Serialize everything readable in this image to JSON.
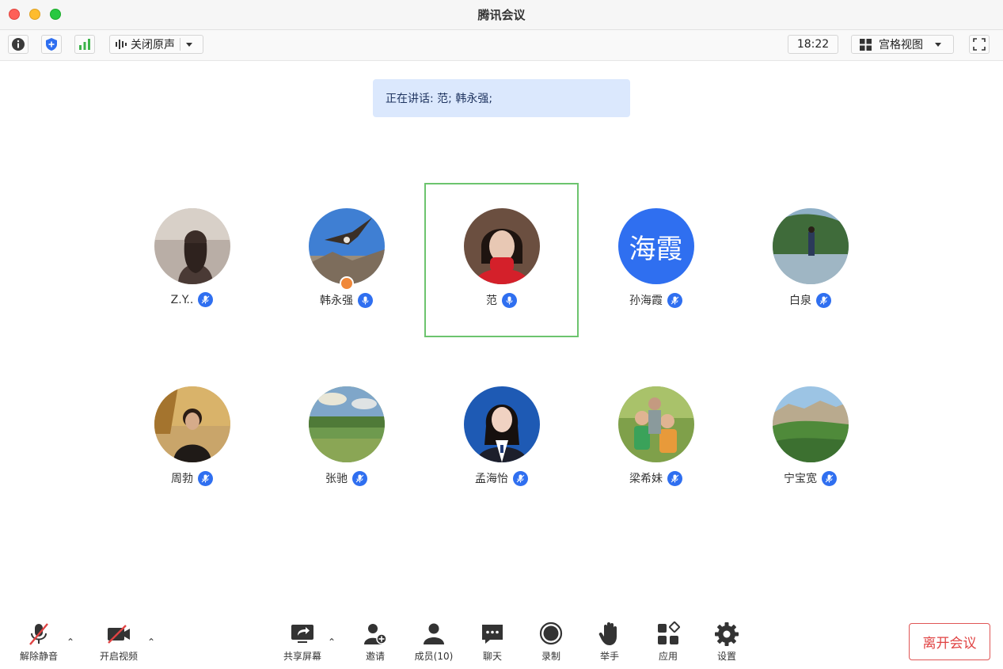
{
  "window": {
    "title": "腾讯会议"
  },
  "toolbar": {
    "original_sound_label": "关闭原声",
    "clock": "18:22",
    "view_label": "宫格视图"
  },
  "banner": {
    "text": "正在讲话: 范; 韩永强;"
  },
  "participants": [
    {
      "name": "Z.Y..",
      "avatar": "photo"
    },
    {
      "name": "韩永强",
      "avatar": "photo"
    },
    {
      "name": "范",
      "avatar": "photo",
      "speaking": true
    },
    {
      "name": "孙海霞",
      "avatar": "text",
      "avatar_text": "海霞"
    },
    {
      "name": "白泉",
      "avatar": "photo"
    },
    {
      "name": "周勃",
      "avatar": "photo"
    },
    {
      "name": "张驰",
      "avatar": "photo"
    },
    {
      "name": "孟海怡",
      "avatar": "photo"
    },
    {
      "name": "梁希妹",
      "avatar": "photo"
    },
    {
      "name": "宁宝宽",
      "avatar": "photo"
    }
  ],
  "bottom": {
    "unmute": "解除静音",
    "start_video": "开启视频",
    "share_screen": "共享屏幕",
    "invite": "邀请",
    "members": "成员(10)",
    "chat": "聊天",
    "record": "录制",
    "raise_hand": "举手",
    "apps": "应用",
    "settings": "设置",
    "leave": "离开会议"
  },
  "colors": {
    "accent": "#2f6ff0",
    "active_border": "#6cc46e",
    "leave": "#e04343",
    "banner_bg": "#dbe8fd"
  }
}
